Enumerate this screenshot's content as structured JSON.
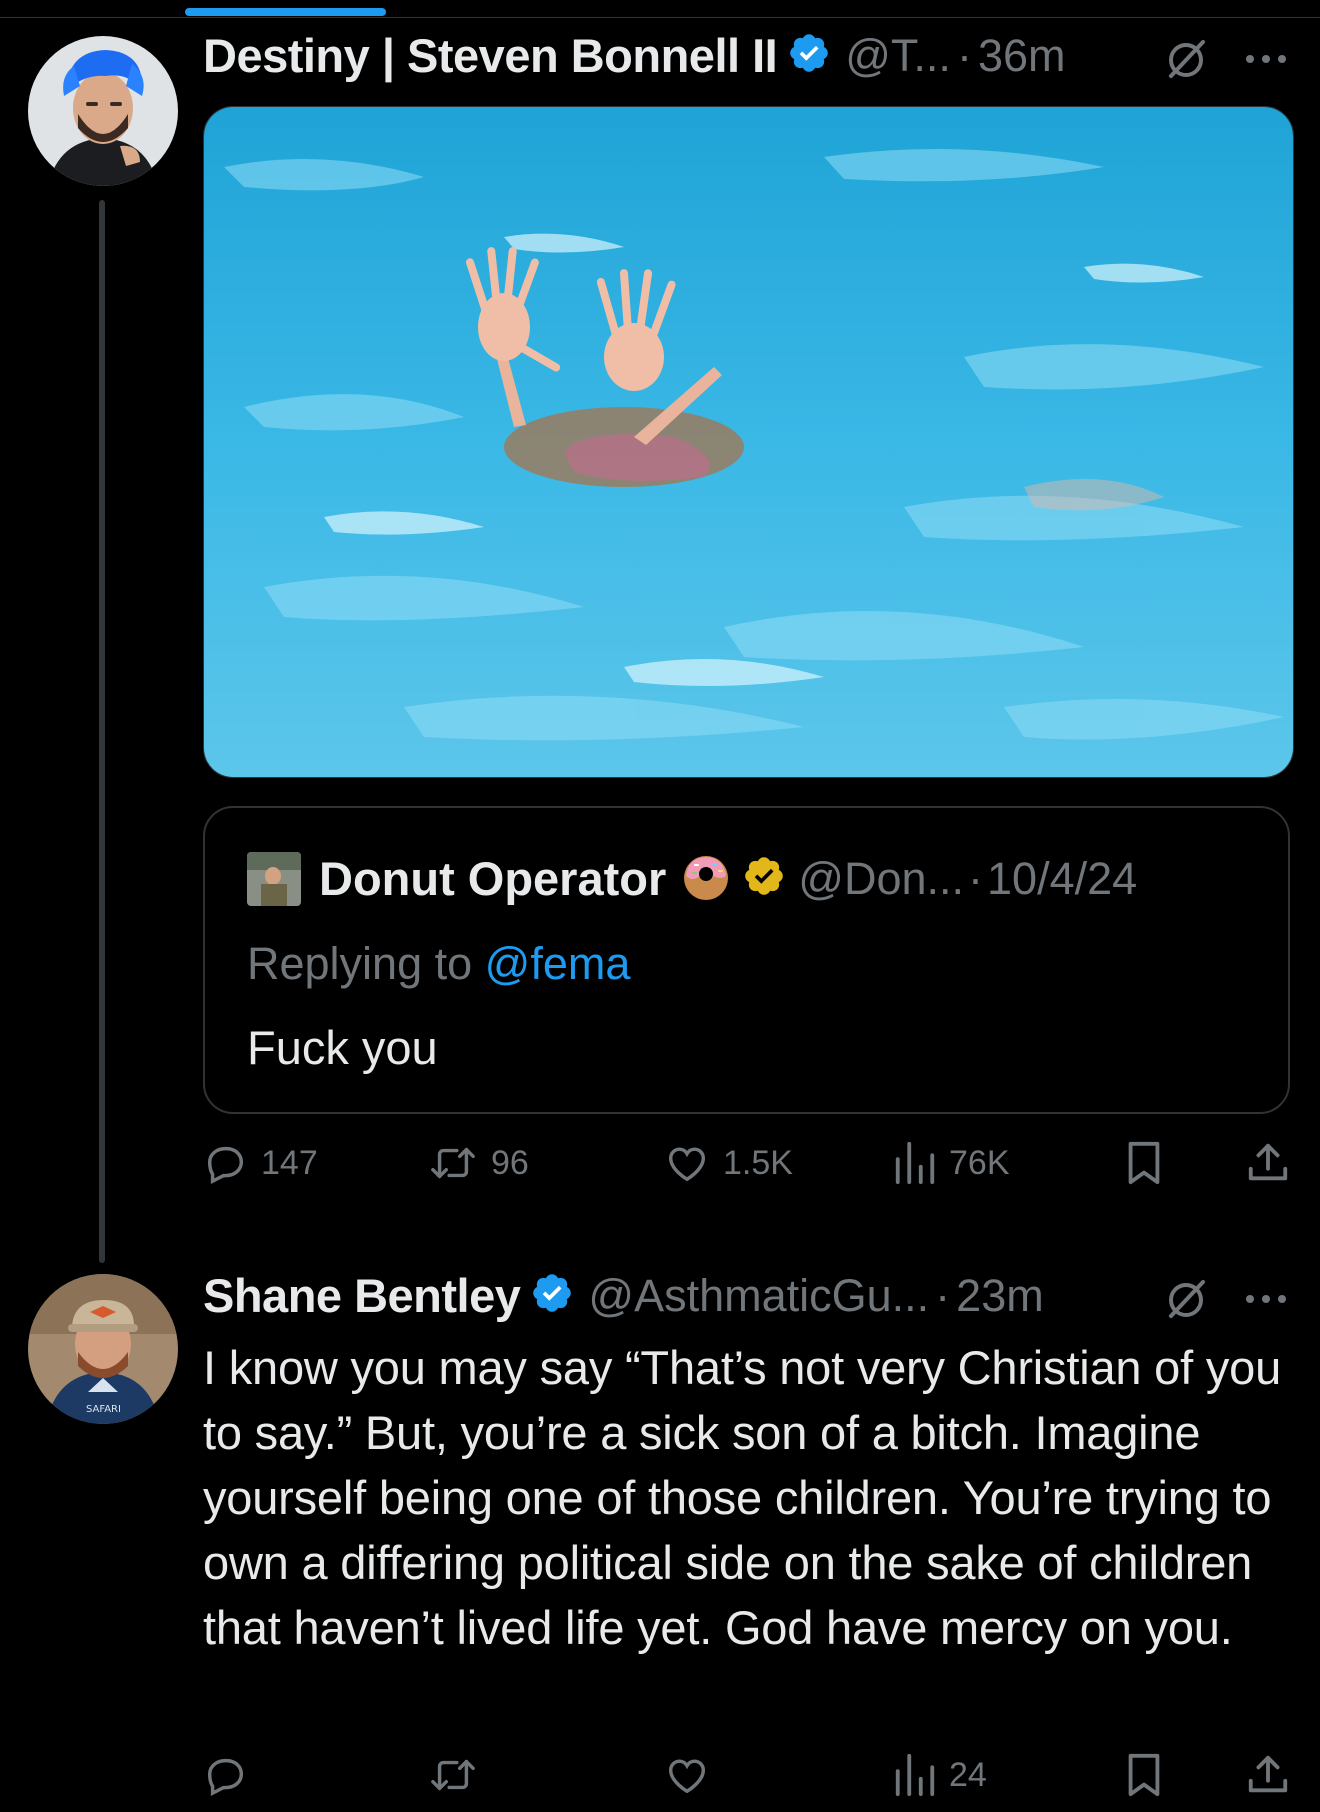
{
  "tweets": [
    {
      "name": "Destiny | Steven Bonnell II",
      "handle": "@T...",
      "dot": "·",
      "time": "36m",
      "media": "drowning-child-pool-photo",
      "quote": {
        "name": "Donut Operator",
        "emoji": "donut",
        "handle": "@Don...",
        "dot": "·",
        "date": "10/4/24",
        "replying_prefix": "Replying to",
        "replying_to": "@fema",
        "text": "Fuck you"
      },
      "actions": {
        "replies": "147",
        "retweets": "96",
        "likes": "1.5K",
        "views": "76K"
      }
    },
    {
      "name": "Shane Bentley",
      "handle": "@AsthmaticGu...",
      "dot": "·",
      "time": "23m",
      "text": "I know you may say “That’s not very Christian of you to say.” But, you’re a sick son of a bitch. Imagine yourself being one of those children. You’re trying to own a differing political side on the sake of children that haven’t lived life yet. God have mercy on you.",
      "actions": {
        "replies": "",
        "retweets": "",
        "likes": "",
        "views": "24"
      }
    }
  ],
  "colors": {
    "background": "#000000",
    "text": "#e7e9ea",
    "muted": "#71767b",
    "accent": "#1d9bf0",
    "border": "#2f3336",
    "gold": "#e2b719"
  }
}
